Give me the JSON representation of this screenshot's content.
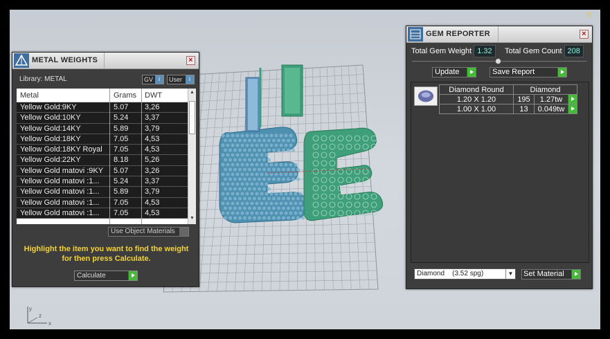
{
  "viewport": {
    "corner_glyph": "∨"
  },
  "axis": {
    "y_label": "y",
    "x_label": "x",
    "z_label": "z"
  },
  "metal_weights": {
    "title": "METAL WEIGHTS",
    "library_label": "Library: METAL",
    "gv_label": "GV",
    "user_label": "User",
    "columns": [
      "Metal",
      "Grams",
      "DWT"
    ],
    "rows": [
      {
        "metal": "Yellow Gold:9KY",
        "grams": "5.07",
        "dwt": "3,26"
      },
      {
        "metal": "Yellow Gold:10KY",
        "grams": "5.24",
        "dwt": "3,37"
      },
      {
        "metal": "Yellow Gold:14KY",
        "grams": "5.89",
        "dwt": "3,79"
      },
      {
        "metal": "Yellow Gold:18KY",
        "grams": "7.05",
        "dwt": "4,53"
      },
      {
        "metal": "Yellow Gold:18KY Royal",
        "grams": "7.05",
        "dwt": "4,53"
      },
      {
        "metal": "Yellow Gold:22KY",
        "grams": "8.18",
        "dwt": "5,26"
      },
      {
        "metal": "Yellow Gold matovi :9KY",
        "grams": "5.07",
        "dwt": "3,26"
      },
      {
        "metal": "Yellow Gold matovi :1...",
        "grams": "5.24",
        "dwt": "3,37"
      },
      {
        "metal": "Yellow Gold matovi :1...",
        "grams": "5.89",
        "dwt": "3,79"
      },
      {
        "metal": "Yellow Gold matovi :1...",
        "grams": "7.05",
        "dwt": "4,53"
      },
      {
        "metal": "Yellow Gold matovi :1...",
        "grams": "7.05",
        "dwt": "4,53"
      }
    ],
    "use_object_materials": "Use Object Materials",
    "hint": "Highlight the item you want to find the weight for then press Calculate.",
    "calculate_label": "Calculate"
  },
  "gem_reporter": {
    "title": "GEM REPORTER",
    "total_gem_weight_label": "Total Gem Weight",
    "total_gem_weight": "1.32",
    "total_gem_count_label": "Total Gem Count",
    "total_gem_count": "208",
    "update_label": "Update",
    "save_report_label": "Save Report",
    "header": [
      "Diamond Round",
      "Diamond"
    ],
    "rows": [
      {
        "size": "1.20 X 1.20",
        "count": "195",
        "weight": "1.27tw"
      },
      {
        "size": "1.00 X 1.00",
        "count": "13",
        "weight": "0.049tw"
      }
    ],
    "material_select": "Diamond    (3.52 spg)",
    "set_material_label": "Set Material"
  },
  "colors": {
    "gem_blue": "#4f8fb0",
    "metal_green": "#3f9f7a",
    "panel_bg": "#3d3d3d",
    "accent_green": "#46b83a",
    "hint_yellow": "#f2d23b"
  }
}
